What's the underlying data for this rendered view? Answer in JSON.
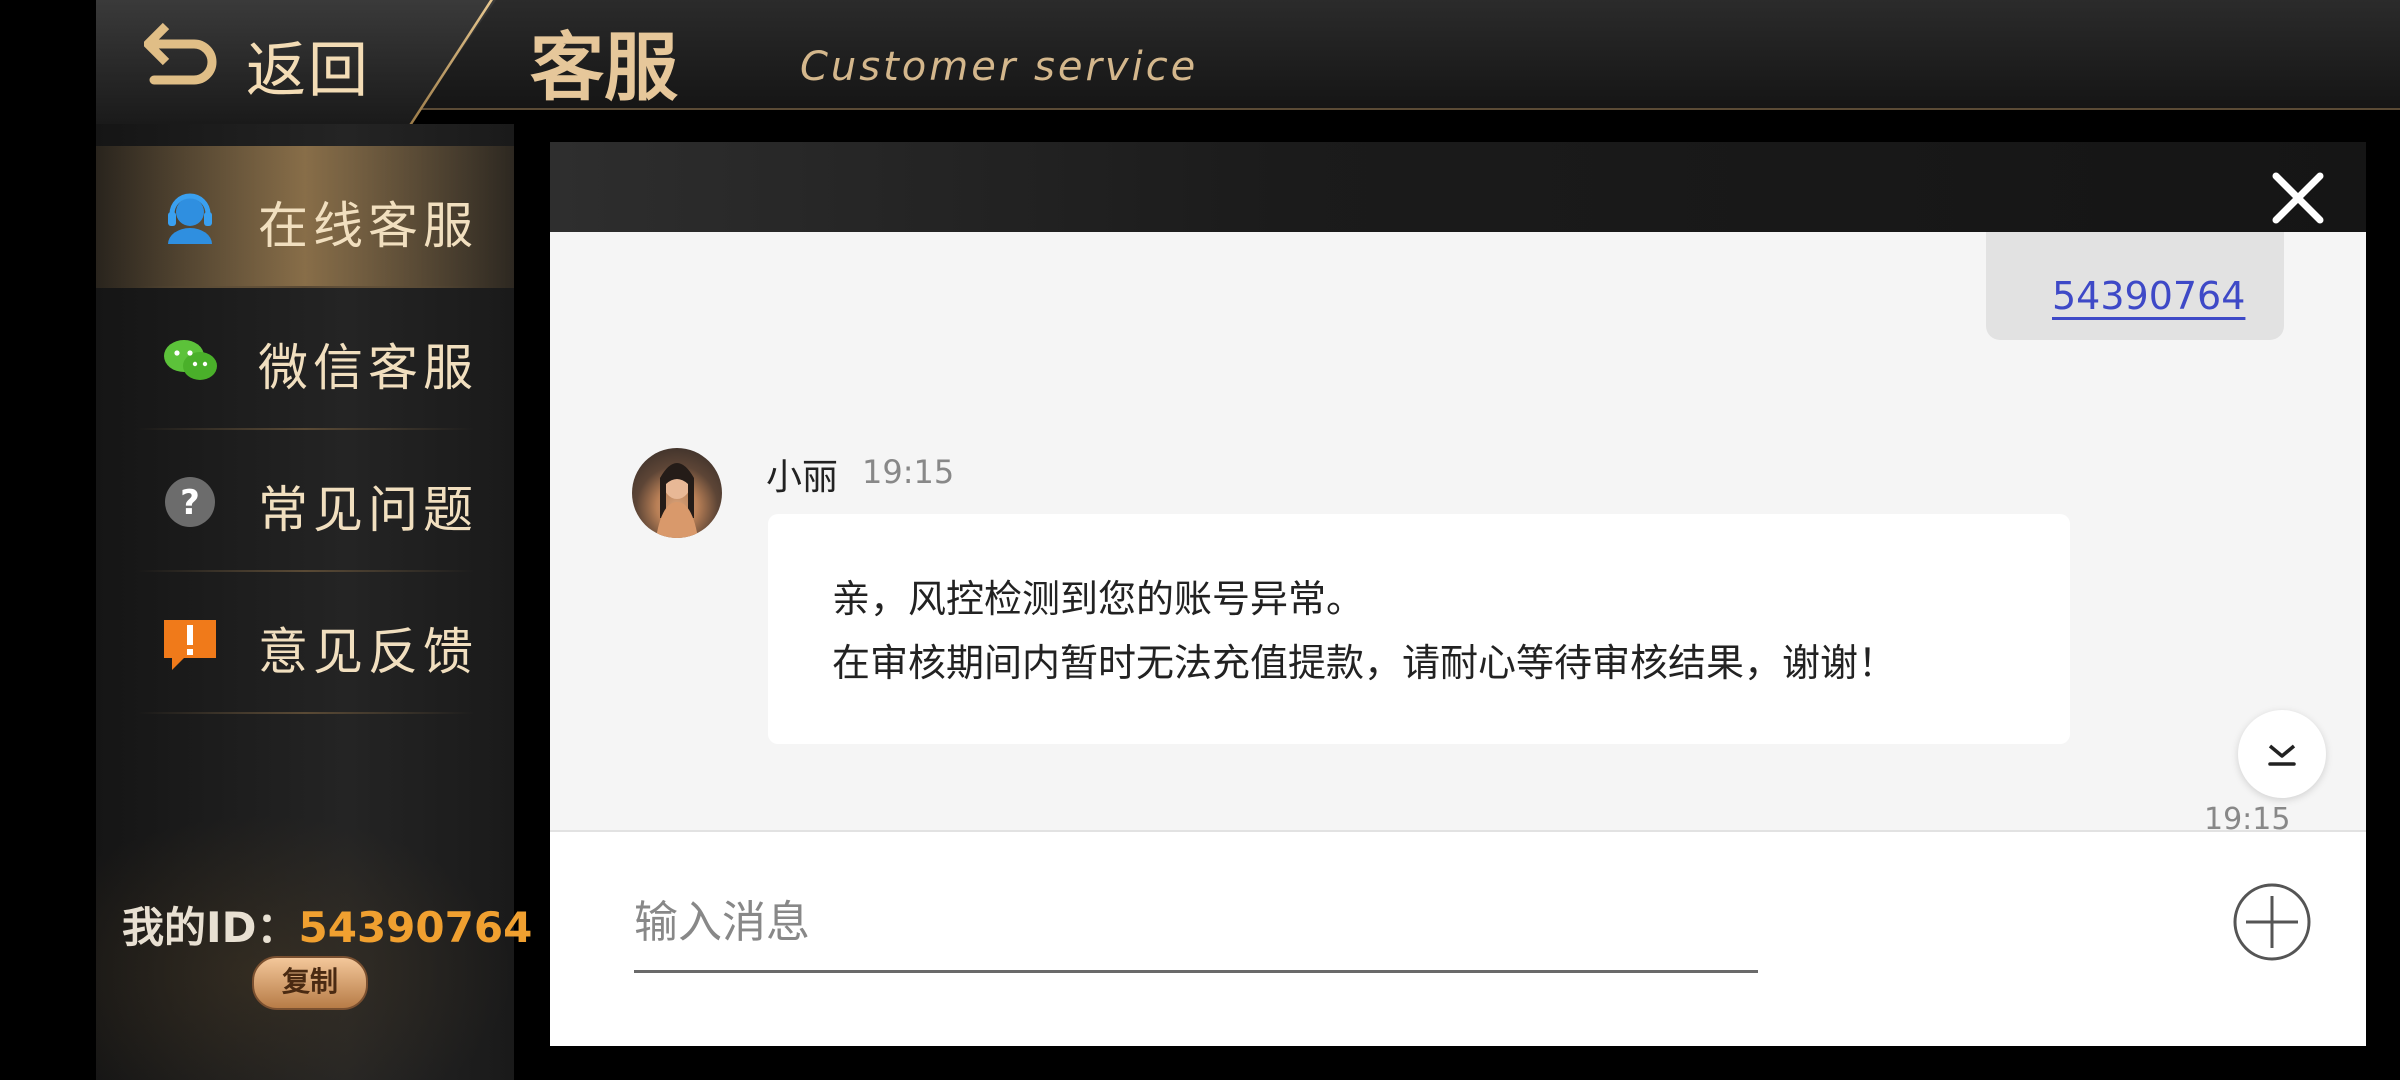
{
  "header": {
    "back_label": "返回",
    "title": "客服",
    "subtitle": "Customer service"
  },
  "sidebar": {
    "items": [
      {
        "label": "在线客服",
        "icon": "headset-icon",
        "active": true
      },
      {
        "label": "微信客服",
        "icon": "wechat-icon",
        "active": false
      },
      {
        "label": "常见问题",
        "icon": "question-icon",
        "active": false
      },
      {
        "label": "意见反馈",
        "icon": "feedback-icon",
        "active": false
      }
    ],
    "my_id_label": "我的ID：",
    "my_id_value": "54390764",
    "copy_label": "复制"
  },
  "chat": {
    "self_message": "54390764",
    "agent_name": "小丽",
    "agent_time": "19:15",
    "agent_message_line1": "亲，风控检测到您的账号异常。",
    "agent_message_line2": "在审核期间内暂时无法充值提款，请耐心等待审核结果，谢谢！",
    "bottom_time": "19:15",
    "input_placeholder": "输入消息"
  },
  "colors": {
    "accent_gold": "#e6c79a",
    "id_orange": "#f0a030",
    "link_blue": "#3e49c7"
  }
}
